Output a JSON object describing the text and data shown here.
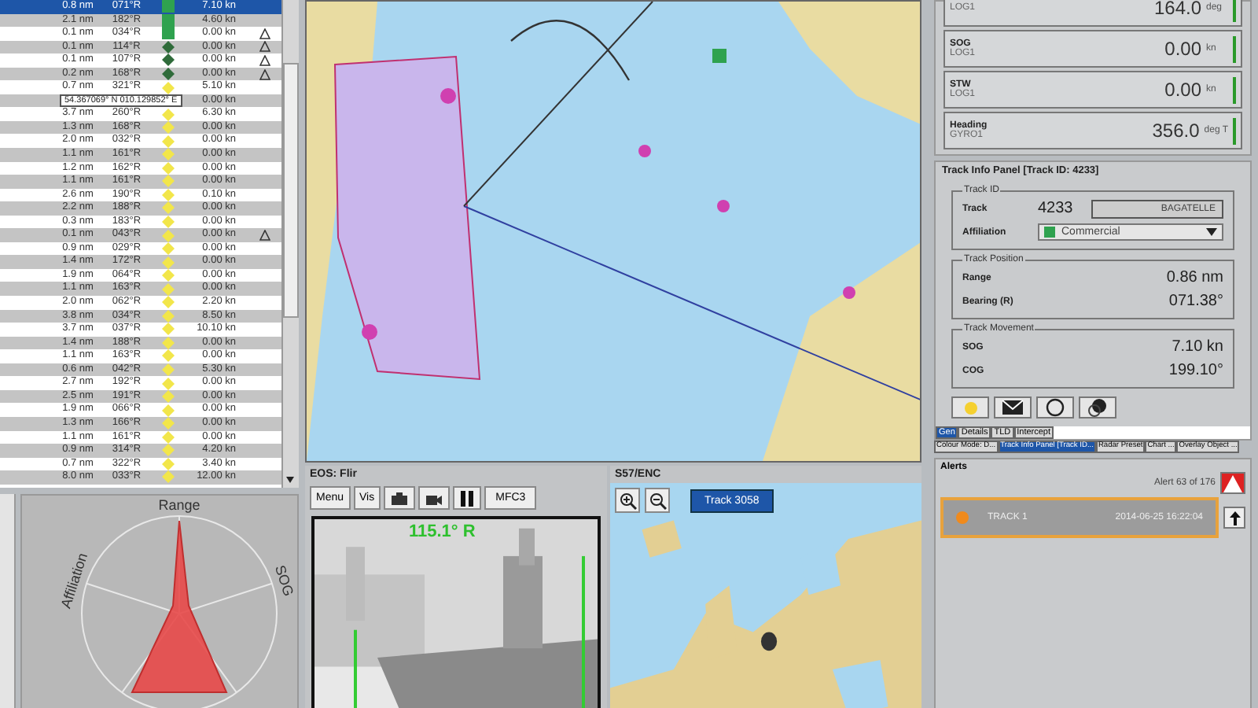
{
  "track_table": {
    "rows": [
      {
        "range": "0.8 nm",
        "bearing": "071°R",
        "kind": "square",
        "color": "#2fa24f",
        "speed": "7.10 kn",
        "alert": false,
        "selected": true
      },
      {
        "range": "2.1 nm",
        "bearing": "182°R",
        "kind": "square",
        "color": "#2fa24f",
        "speed": "4.60 kn",
        "alert": false,
        "selected": false
      },
      {
        "range": "0.1 nm",
        "bearing": "034°R",
        "kind": "square",
        "color": "#2fa24f",
        "speed": "0.00 kn",
        "alert": true,
        "selected": false
      },
      {
        "range": "0.1 nm",
        "bearing": "114°R",
        "kind": "diamond",
        "color": "#2f6b3a",
        "speed": "0.00 kn",
        "alert": true,
        "selected": false
      },
      {
        "range": "0.1 nm",
        "bearing": "107°R",
        "kind": "diamond",
        "color": "#2f6b3a",
        "speed": "0.00 kn",
        "alert": true,
        "selected": false
      },
      {
        "range": "0.2 nm",
        "bearing": "168°R",
        "kind": "diamond",
        "color": "#2f6b3a",
        "speed": "0.00 kn",
        "alert": true,
        "selected": false
      },
      {
        "range": "0.7 nm",
        "bearing": "321°R",
        "kind": "diamond",
        "color": "#f2e64a",
        "speed": "5.10 kn",
        "alert": false,
        "selected": false
      },
      {
        "speed": "0.00 kn",
        "alert": false,
        "selected": false
      },
      {
        "range": "3.7 nm",
        "bearing": "260°R",
        "kind": "diamond",
        "color": "#f2e64a",
        "speed": "6.30 kn",
        "alert": false,
        "selected": false
      },
      {
        "range": "1.3 nm",
        "bearing": "168°R",
        "kind": "diamond",
        "color": "#f2e64a",
        "speed": "0.00 kn",
        "alert": false,
        "selected": false
      },
      {
        "range": "2.0 nm",
        "bearing": "032°R",
        "kind": "diamond",
        "color": "#f2e64a",
        "speed": "0.00 kn",
        "alert": false,
        "selected": false
      },
      {
        "range": "1.1 nm",
        "bearing": "161°R",
        "kind": "diamond",
        "color": "#f2e64a",
        "speed": "0.00 kn",
        "alert": false,
        "selected": false
      },
      {
        "range": "1.2 nm",
        "bearing": "162°R",
        "kind": "diamond",
        "color": "#f2e64a",
        "speed": "0.00 kn",
        "alert": false,
        "selected": false
      },
      {
        "range": "1.1 nm",
        "bearing": "161°R",
        "kind": "diamond",
        "color": "#f2e64a",
        "speed": "0.00 kn",
        "alert": false,
        "selected": false
      },
      {
        "range": "2.6 nm",
        "bearing": "190°R",
        "kind": "diamond",
        "color": "#f2e64a",
        "speed": "0.10 kn",
        "alert": false,
        "selected": false
      },
      {
        "range": "2.2 nm",
        "bearing": "188°R",
        "kind": "diamond",
        "color": "#f2e64a",
        "speed": "0.00 kn",
        "alert": false,
        "selected": false
      },
      {
        "range": "0.3 nm",
        "bearing": "183°R",
        "kind": "diamond",
        "color": "#f2e64a",
        "speed": "0.00 kn",
        "alert": false,
        "selected": false
      },
      {
        "range": "0.1 nm",
        "bearing": "043°R",
        "kind": "diamond",
        "color": "#f2e64a",
        "speed": "0.00 kn",
        "alert": true,
        "selected": false
      },
      {
        "range": "0.9 nm",
        "bearing": "029°R",
        "kind": "diamond",
        "color": "#f2e64a",
        "speed": "0.00 kn",
        "alert": false,
        "selected": false
      },
      {
        "range": "1.4 nm",
        "bearing": "172°R",
        "kind": "diamond",
        "color": "#f2e64a",
        "speed": "0.00 kn",
        "alert": false,
        "selected": false
      },
      {
        "range": "1.9 nm",
        "bearing": "064°R",
        "kind": "diamond",
        "color": "#f2e64a",
        "speed": "0.00 kn",
        "alert": false,
        "selected": false
      },
      {
        "range": "1.1 nm",
        "bearing": "163°R",
        "kind": "diamond",
        "color": "#f2e64a",
        "speed": "0.00 kn",
        "alert": false,
        "selected": false
      },
      {
        "range": "2.0 nm",
        "bearing": "062°R",
        "kind": "diamond",
        "color": "#f2e64a",
        "speed": "2.20 kn",
        "alert": false,
        "selected": false
      },
      {
        "range": "3.8 nm",
        "bearing": "034°R",
        "kind": "diamond",
        "color": "#f2e64a",
        "speed": "8.50 kn",
        "alert": false,
        "selected": false
      },
      {
        "range": "3.7 nm",
        "bearing": "037°R",
        "kind": "diamond",
        "color": "#f2e64a",
        "speed": "10.10 kn",
        "alert": false,
        "selected": false
      },
      {
        "range": "1.4 nm",
        "bearing": "188°R",
        "kind": "diamond",
        "color": "#f2e64a",
        "speed": "0.00 kn",
        "alert": false,
        "selected": false
      },
      {
        "range": "1.1 nm",
        "bearing": "163°R",
        "kind": "diamond",
        "color": "#f2e64a",
        "speed": "0.00 kn",
        "alert": false,
        "selected": false
      },
      {
        "range": "0.6 nm",
        "bearing": "042°R",
        "kind": "diamond",
        "color": "#f2e64a",
        "speed": "5.30 kn",
        "alert": false,
        "selected": false
      },
      {
        "range": "2.7 nm",
        "bearing": "192°R",
        "kind": "diamond",
        "color": "#f2e64a",
        "speed": "0.00 kn",
        "alert": false,
        "selected": false
      },
      {
        "range": "2.5 nm",
        "bearing": "191°R",
        "kind": "diamond",
        "color": "#f2e64a",
        "speed": "0.00 kn",
        "alert": false,
        "selected": false
      },
      {
        "range": "1.9 nm",
        "bearing": "066°R",
        "kind": "diamond",
        "color": "#f2e64a",
        "speed": "0.00 kn",
        "alert": false,
        "selected": false
      },
      {
        "range": "1.3 nm",
        "bearing": "166°R",
        "kind": "diamond",
        "color": "#f2e64a",
        "speed": "0.00 kn",
        "alert": false,
        "selected": false
      },
      {
        "range": "1.1 nm",
        "bearing": "161°R",
        "kind": "diamond",
        "color": "#f2e64a",
        "speed": "0.00 kn",
        "alert": false,
        "selected": false
      },
      {
        "range": "0.9 nm",
        "bearing": "314°R",
        "kind": "diamond",
        "color": "#f2e64a",
        "speed": "4.20 kn",
        "alert": false,
        "selected": false
      },
      {
        "range": "0.7 nm",
        "bearing": "322°R",
        "kind": "diamond",
        "color": "#f2e64a",
        "speed": "3.40 kn",
        "alert": false,
        "selected": false
      },
      {
        "range": "8.0 nm",
        "bearing": "033°R",
        "kind": "diamond",
        "color": "#f2e64a",
        "speed": "12.00 kn",
        "alert": false,
        "selected": false
      }
    ],
    "tooltip": "54.367069° N   010.129852° E"
  },
  "radar": {
    "axes": [
      "Range",
      "SOG",
      "Affiliation"
    ]
  },
  "flir": {
    "title": "EOS: Flir",
    "menus": [
      "Menu",
      "Vis"
    ],
    "mfc_button": "MFC3",
    "bearing_overlay": "115.1° R"
  },
  "enc": {
    "title": "S57/ENC",
    "track_button": "Track 3058"
  },
  "sensors": [
    {
      "source": "LOG1",
      "value": "164.0",
      "unit": "deg"
    },
    {
      "name": "SOG",
      "source": "LOG1",
      "value": "0.00",
      "unit": "kn"
    },
    {
      "name": "STW",
      "source": "LOG1",
      "value": "0.00",
      "unit": "kn"
    },
    {
      "name": "Heading",
      "source": "GYRO1",
      "value": "356.0",
      "unit": "deg T"
    }
  ],
  "track_info": {
    "title": "Track Info Panel [Track ID: 4233]",
    "track_id": {
      "legend": "Track ID",
      "track_label": "Track",
      "track_number": "4233",
      "name": "BAGATELLE",
      "affiliation_label": "Affiliation",
      "affiliation": {
        "value": "Commercial",
        "color": "#2fa24f"
      }
    },
    "position": {
      "legend": "Track Position",
      "fields": [
        {
          "label": "Range",
          "value": "0.86 nm"
        },
        {
          "label": "Bearing (R)",
          "value": "071.38°"
        }
      ]
    },
    "movement": {
      "legend": "Track Movement",
      "fields": [
        {
          "label": "SOG",
          "value": "7.10 kn"
        },
        {
          "label": "COG",
          "value": "199.10°"
        }
      ]
    },
    "tabs": [
      {
        "label": "Gen",
        "selected": true
      },
      {
        "label": "Details",
        "selected": false
      },
      {
        "label": "TLD",
        "selected": false
      },
      {
        "label": "Intercept",
        "selected": false
      }
    ]
  },
  "panel_tabs": [
    {
      "label": "Colour Mode: D...",
      "selected": false
    },
    {
      "label": "Track Info Panel [Track ID...",
      "selected": true
    },
    {
      "label": "Radar Preset",
      "selected": false
    },
    {
      "label": "Chart ...",
      "selected": false
    },
    {
      "label": "Overlay Object ...",
      "selected": false
    }
  ],
  "alerts": {
    "title": "Alerts",
    "count": "Alert 63 of 176",
    "items": [
      {
        "name": "TRACK 1",
        "time": "2014-06-25 16:22:04",
        "color": "#f08a1c"
      }
    ]
  }
}
